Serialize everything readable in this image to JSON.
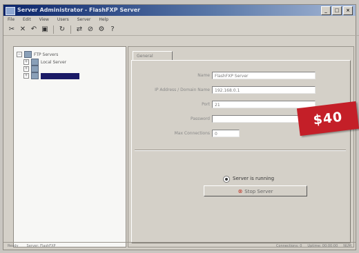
{
  "window": {
    "title": "Server Administrator - FlashFXP Server",
    "buttons": [
      "_",
      "□",
      "×"
    ]
  },
  "menu": [
    "File",
    "Edit",
    "View",
    "Users",
    "Server",
    "Help"
  ],
  "toolbar_icons": [
    "cut-icon",
    "delete-icon",
    "undo-icon",
    "save-icon",
    "refresh-icon",
    "connect-icon",
    "disconnect-icon",
    "settings-icon",
    "help-icon"
  ],
  "tree": {
    "items": [
      {
        "label": "FTP Servers",
        "selected": false
      },
      {
        "label": "Local Server",
        "selected": false
      },
      {
        "label": "",
        "selected": false
      },
      {
        "label": "",
        "selected": true
      }
    ]
  },
  "tab": {
    "label": "General"
  },
  "form": {
    "fields": [
      {
        "label": "Name",
        "value": "FlashFXP Server"
      },
      {
        "label": "IP Address / Domain Name",
        "value": "192.168.0.1"
      },
      {
        "label": "Port",
        "value": "21"
      },
      {
        "label": "Password",
        "value": ""
      },
      {
        "label": "Max Connections",
        "value": "0"
      }
    ]
  },
  "server": {
    "status": "Server is running",
    "stop_button": "Stop Server"
  },
  "price": "$40",
  "statusbar": {
    "left": "Ready",
    "middle": "Server: FlashFXP",
    "right": [
      "Connections: 0",
      "Uptime: 00:00:00",
      "NUM"
    ]
  },
  "colors": {
    "badge": "#c41f28",
    "title_bar": "#0a246a",
    "selected": "#1a1a66"
  }
}
